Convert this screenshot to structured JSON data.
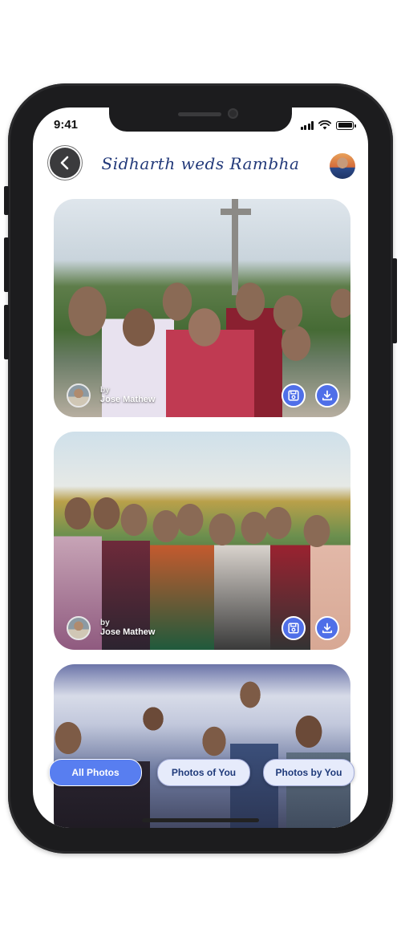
{
  "status_bar": {
    "time": "9:41"
  },
  "header": {
    "title": "Sidharth weds Rambha"
  },
  "photos": [
    {
      "by_label": "by",
      "uploader": "Jose Mathew"
    },
    {
      "by_label": "by",
      "uploader": "Jose Mathew"
    },
    {
      "by_label": "",
      "uploader": ""
    }
  ],
  "tabs": [
    {
      "label": "All Photos",
      "active": true
    },
    {
      "label": "Photos of You",
      "active": false
    },
    {
      "label": "Photos by You",
      "active": false
    }
  ],
  "colors": {
    "accent": "#587ef0",
    "title": "#233a7a",
    "tab_inactive_bg": "#e6ebfb"
  },
  "icons": [
    "chevron-left-icon",
    "save-icon",
    "download-icon",
    "wifi-icon",
    "signal-icon",
    "battery-icon"
  ]
}
